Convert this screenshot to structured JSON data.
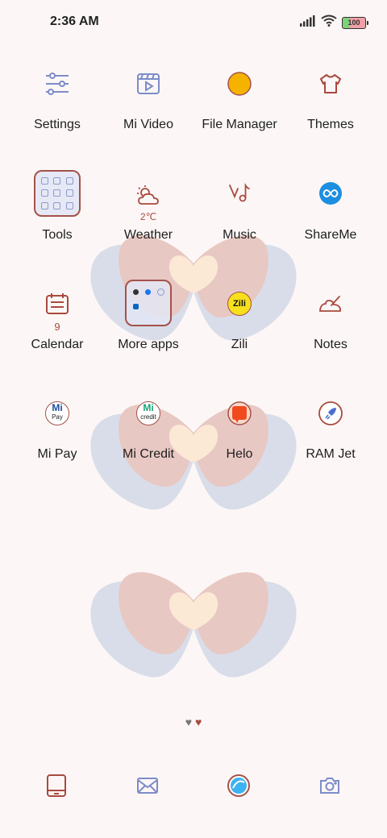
{
  "status_bar": {
    "time": "2:36 AM",
    "battery": "100"
  },
  "apps": {
    "settings": {
      "label": "Settings"
    },
    "mi_video": {
      "label": "Mi Video"
    },
    "file_manager": {
      "label": "File Manager"
    },
    "themes": {
      "label": "Themes"
    },
    "tools": {
      "label": "Tools"
    },
    "weather": {
      "label": "Weather",
      "temperature": "2℃"
    },
    "music": {
      "label": "Music"
    },
    "shareme": {
      "label": "ShareMe"
    },
    "calendar": {
      "label": "Calendar",
      "date": "9"
    },
    "more_apps": {
      "label": "More apps"
    },
    "zili": {
      "label": "Zili",
      "logo": "Zili"
    },
    "notes": {
      "label": "Notes"
    },
    "mi_pay": {
      "label": "Mi Pay",
      "logo": "Pay"
    },
    "mi_credit": {
      "label": "Mi Credit",
      "logo": "credit"
    },
    "helo": {
      "label": "Helo"
    },
    "ram_jet": {
      "label": "RAM Jet"
    }
  },
  "page_indicator": {
    "pages": 2,
    "current": 2
  },
  "dock": [
    "tablet-icon",
    "mail-icon",
    "browser-icon",
    "camera-icon"
  ],
  "colors": {
    "accent_red": "#a94a3e",
    "accent_blue": "#7d8cc9",
    "background": "#fcf7f6"
  }
}
